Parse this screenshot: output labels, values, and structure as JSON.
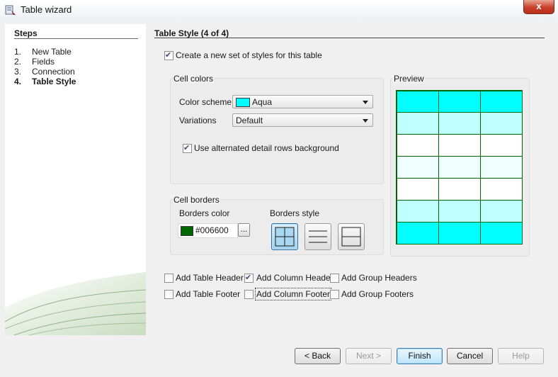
{
  "window": {
    "title": "Table wizard",
    "close_glyph": "x"
  },
  "steps": {
    "title": "Steps",
    "items": [
      {
        "num": "1.",
        "label": "New Table",
        "active": false
      },
      {
        "num": "2.",
        "label": "Fields",
        "active": false
      },
      {
        "num": "3.",
        "label": "Connection",
        "active": false
      },
      {
        "num": "4.",
        "label": "Table Style",
        "active": true
      }
    ]
  },
  "content": {
    "section_title": "Table Style (4 of 4)",
    "create_styles": {
      "label": "Create a new set of styles for this table",
      "checked": true
    },
    "cell_colors": {
      "title": "Cell colors",
      "color_scheme": {
        "label": "Color scheme",
        "value": "Aqua",
        "swatch": "#00ffff"
      },
      "variations": {
        "label": "Variations",
        "value": "Default"
      },
      "alternated": {
        "label": "Use alternated detail rows background",
        "checked": true
      }
    },
    "cell_borders": {
      "title": "Cell borders",
      "borders_color_label": "Borders color",
      "borders_color_value": "#006600",
      "more_button": "...",
      "borders_style_label": "Borders style",
      "styles": [
        "all-borders",
        "horizontal-borders",
        "outer-and-horizontal-borders"
      ],
      "selected_style": "all-borders"
    },
    "preview": {
      "title": "Preview",
      "border_color": "#006600",
      "row_colors": [
        "#00ffff",
        "#bfffff",
        "#ffffff",
        "#efffff",
        "#ffffff",
        "#bfffff",
        "#00ffff"
      ]
    },
    "options": [
      {
        "label": "Add Table Header",
        "checked": false
      },
      {
        "label": "Add Column Header",
        "checked": true
      },
      {
        "label": "Add Group Headers",
        "checked": false
      },
      {
        "label": "Add Table Footer",
        "checked": false
      },
      {
        "label": "Add Column Footer",
        "checked": false
      },
      {
        "label": "Add Group Footers",
        "checked": false
      }
    ]
  },
  "buttons": {
    "back": "< Back",
    "next": "Next >",
    "finish": "Finish",
    "cancel": "Cancel",
    "help": "Help"
  }
}
